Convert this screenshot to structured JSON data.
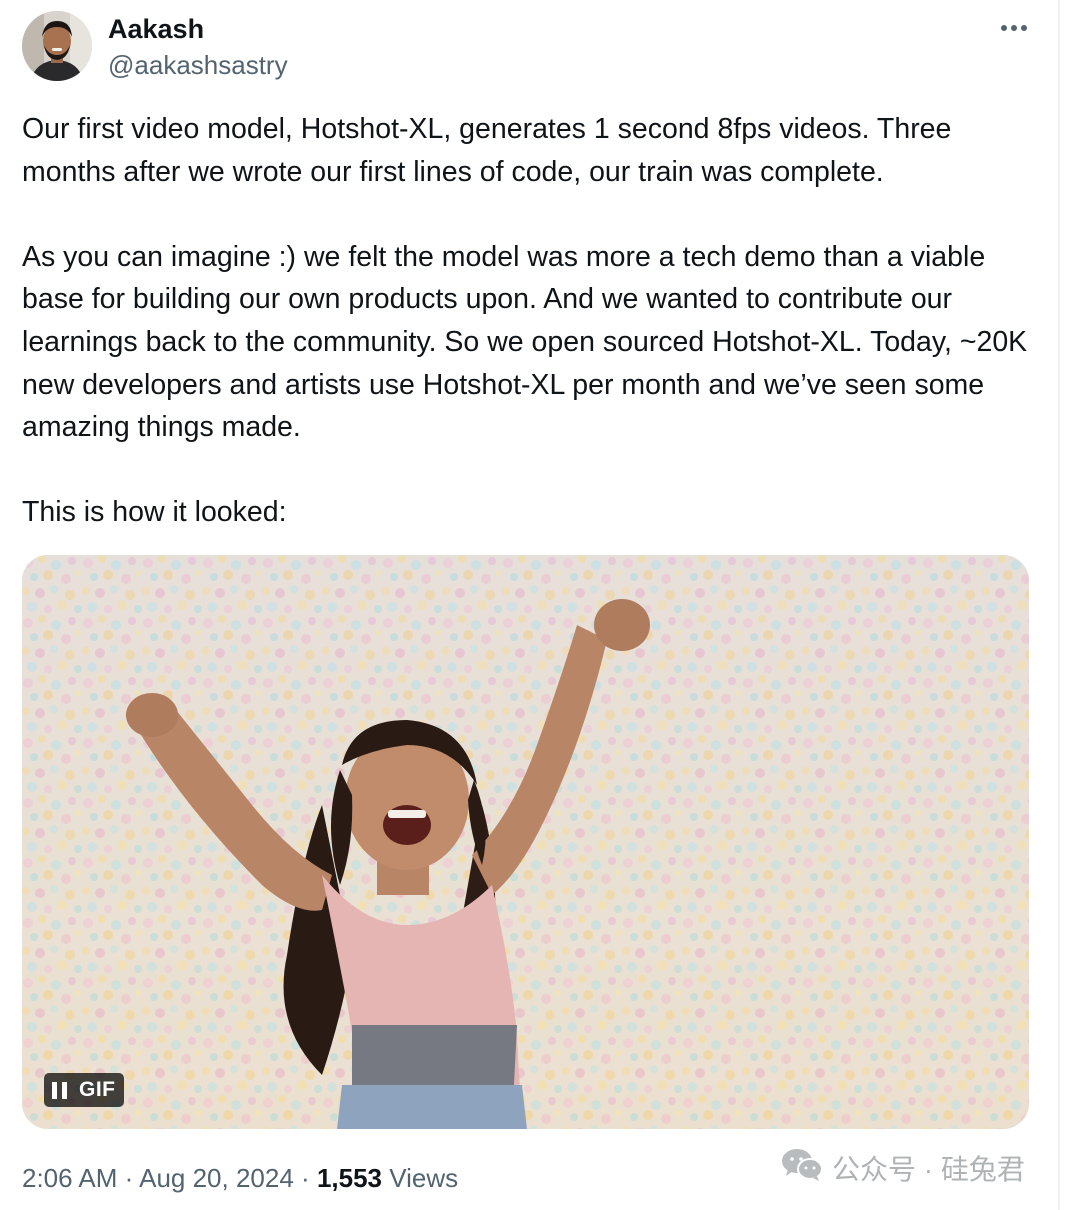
{
  "author": {
    "display_name": "Aakash",
    "handle": "@aakashsastry"
  },
  "post": {
    "paragraphs": [
      "Our first video model, Hotshot-XL, generates 1 second 8fps videos. Three months after we wrote our first lines of code, our train was complete.",
      "As you can imagine :) we felt the model was more a tech demo than a viable base for building our own products upon. And we wanted to contribute our learnings back to the community. So we open sourced Hotshot-XL. Today, ~20K new developers and artists use Hotshot-XL per month and we’ve seen some amazing things made.",
      "This is how it looked:"
    ]
  },
  "media": {
    "type": "gif",
    "badge_label": "GIF"
  },
  "meta": {
    "time": "2:06 AM",
    "separator": "·",
    "date": "Aug 20, 2024",
    "views_count": "1,553",
    "views_label": "Views"
  },
  "watermark": {
    "text": "公众号 · 硅兔君"
  },
  "icons": {
    "more": "more-horizontal-icon",
    "pause": "pause-icon",
    "wechat": "wechat-icon"
  }
}
